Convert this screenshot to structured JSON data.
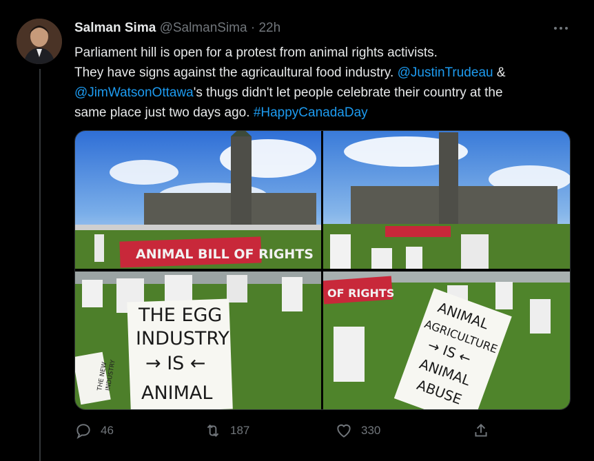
{
  "tweet": {
    "display_name": "Salman Sima",
    "handle": "@SalmanSima",
    "separator": "·",
    "time": "22h",
    "text_line1": "Parliament hill is open for a protest from animal rights activists.",
    "text_line2_a": "They have signs against the agricaultural food industry.",
    "mention1": "@JustinTrudeau",
    "amp": "&",
    "mention2": "@JimWatsonOttawa",
    "text_line3_b": "'s thugs didn't let people celebrate their country at the",
    "text_line4_a": "same place just two days ago.",
    "hashtag": "#HappyCanadaDay"
  },
  "media": {
    "banner_text": "ANIMAL BILL OF RIGHTS",
    "banner_text_partial": "OF RIGHTS",
    "sign1": [
      "THE EGG",
      "INDUSTRY",
      "→ IS ←",
      "ANIMAL"
    ],
    "sign2": [
      "ANIMAL",
      "AGRICULTURE",
      "→ IS ←",
      "ANIMAL",
      "ABUSE"
    ],
    "small_sign": [
      "THE NEW",
      "INDUSTRY"
    ]
  },
  "actions": {
    "replies": "46",
    "retweets": "187",
    "likes": "330"
  },
  "colors": {
    "link": "#1d9bf0",
    "muted": "#71767b",
    "banner": "#c8283a"
  }
}
